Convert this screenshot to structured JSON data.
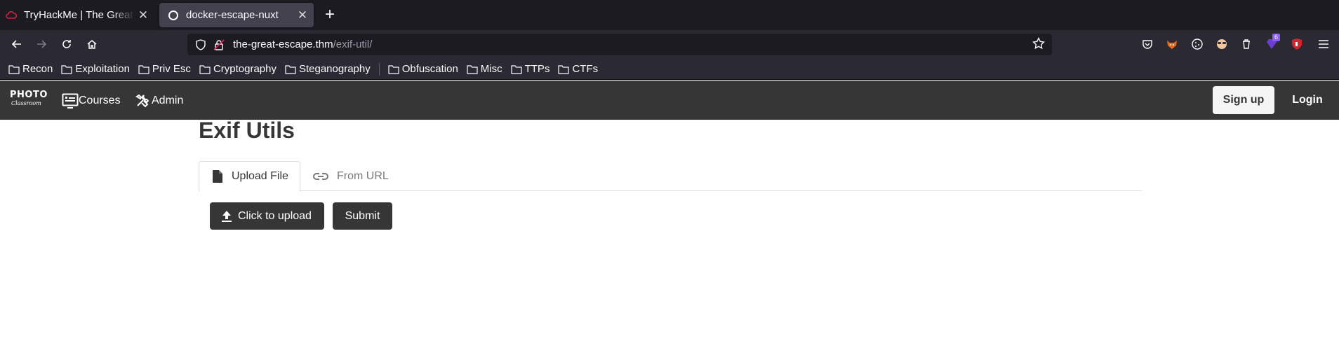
{
  "browser": {
    "tabs": [
      {
        "title": "TryHackMe | The Great Escape",
        "active": false
      },
      {
        "title": "docker-escape-nuxt",
        "active": true
      }
    ],
    "url": {
      "host": "the-great-escape.thm",
      "path": "/exif-util/"
    },
    "extension_badge": "6",
    "bookmarks": [
      "Recon",
      "Exploitation",
      "Priv Esc",
      "Cryptography",
      "Steganography",
      "Obfuscation",
      "Misc",
      "TTPs",
      "CTFs"
    ]
  },
  "app": {
    "logo_line1": "PHOTO",
    "logo_line2": "Classroom",
    "nav": {
      "courses": "Courses",
      "admin": "Admin"
    },
    "signup": "Sign up",
    "login": "Login"
  },
  "page": {
    "title": "Exif Utils",
    "tabs": {
      "upload": "Upload File",
      "url": "From URL"
    },
    "upload_button": "Click to upload",
    "submit_button": "Submit"
  },
  "colors": {
    "appbar": "#363636",
    "dark_button": "#363636",
    "tab_bg": "#1c1b22",
    "toolbar_bg": "#2b2a33"
  }
}
